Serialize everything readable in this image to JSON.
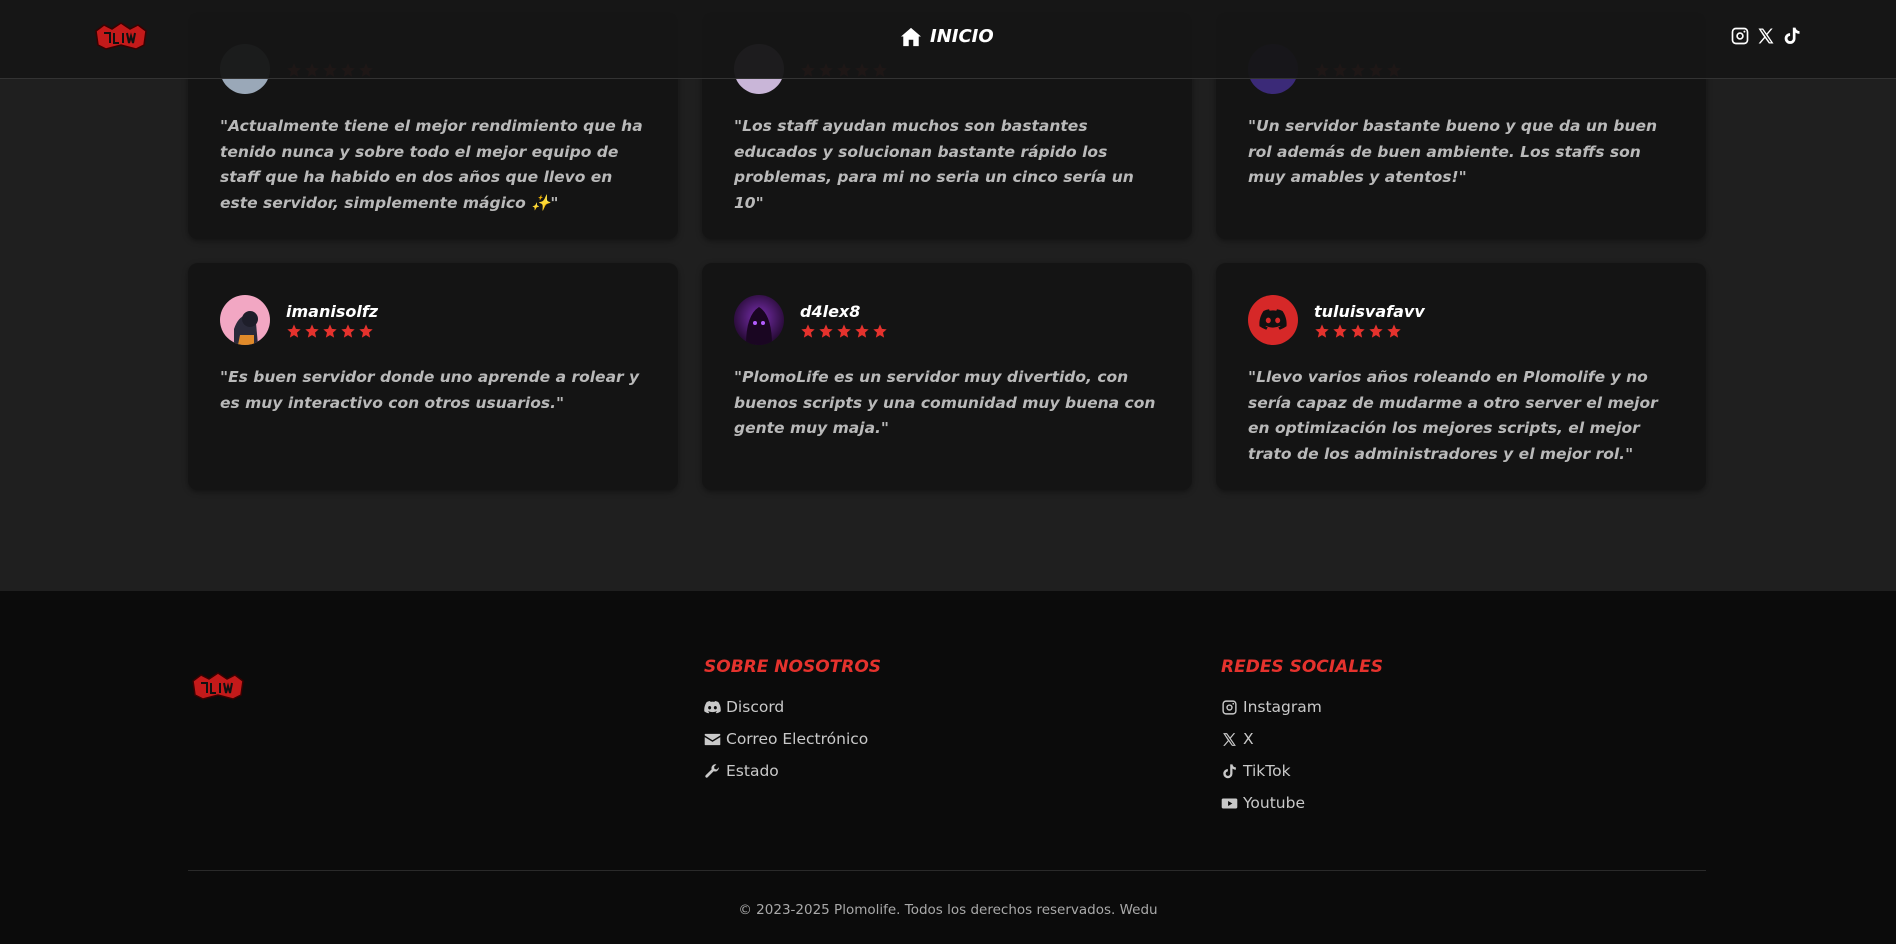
{
  "nav": {
    "home_label": "INICIO",
    "logo_icon": "plomolife-logo-icon",
    "social_icons": [
      "instagram-icon",
      "x-icon",
      "tiktok-icon"
    ]
  },
  "reviews": [
    {
      "username": "",
      "rating": 5,
      "quote": "\"Actualmente tiene el mejor rendimiento que ha tenido nunca y sobre todo el mejor equipo de staff que ha habido en dos años que llevo en este servidor, simplemente mágico ✨\"",
      "avatar_color": "#9aa8b8"
    },
    {
      "username": "",
      "rating": 5,
      "quote": "\"Los staff ayudan muchos son bastantes educados y solucionan bastante rápido los problemas, para mi no seria un cinco sería un 10\"",
      "avatar_color": "#c9b6d8"
    },
    {
      "username": "",
      "rating": 5,
      "quote": "\"Un servidor bastante bueno y que da un buen rol además de buen ambiente. Los staffs son muy amables y atentos!\"",
      "avatar_color": "#3b2a78"
    },
    {
      "username": "imanisolfz",
      "rating": 5,
      "quote": "\"Es buen servidor donde uno aprende a rolear y es muy interactivo con otros usuarios.\"",
      "avatar_color": "#f2a7c3"
    },
    {
      "username": "d4lex8",
      "rating": 5,
      "quote": "\"PlomoLife es un servidor muy divertido, con buenos scripts y una comunidad muy buena con gente muy maja.\"",
      "avatar_color": "#5a1f7a"
    },
    {
      "username": "tuluisvafavv",
      "rating": 5,
      "quote": "\"Llevo varios años roleando en Plomolife y no sería capaz de mudarme a otro server el mejor en optimización los mejores scripts, el mejor trato de los administradores y el mejor rol.\"",
      "avatar_color": "#d62828"
    }
  ],
  "footer": {
    "about_heading": "SOBRE NOSOTROS",
    "about_links": [
      "Discord",
      "Correo Electrónico",
      "Estado"
    ],
    "social_heading": "REDES SOCIALES",
    "social_links": [
      "Instagram",
      "X",
      "TikTok",
      "Youtube"
    ],
    "copyright": "© 2023-2025 Plomolife. Todos los derechos reservados. Wedu"
  },
  "colors": {
    "accent": "#e5322d",
    "card_bg": "#141414",
    "page_bg": "#1f1f1f",
    "footer_bg": "#0b0b0b"
  }
}
